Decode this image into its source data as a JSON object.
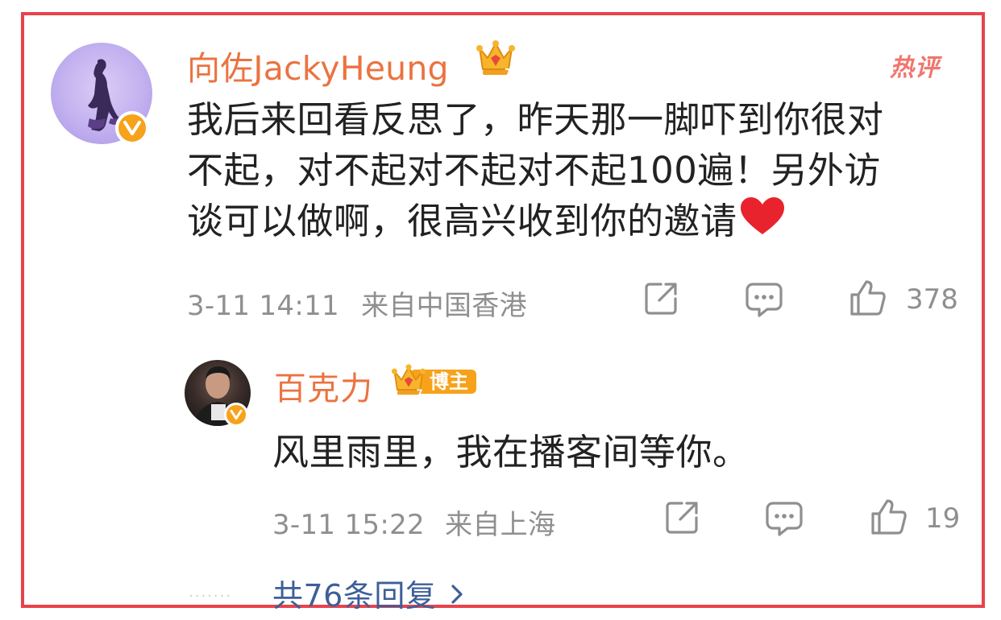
{
  "comment": {
    "username": "向佐JackyHeung",
    "hot_label": "热评",
    "text_line1": "我后来回看反思了，昨天那一脚吓到你很对",
    "text_line2": "不起，对不起对不起对不起100遍！另外访",
    "text_line3": "谈可以做啊，很高兴收到你的邀请",
    "time": "3-11 14:11",
    "location": "来自中国香港",
    "like_count": "378"
  },
  "reply": {
    "username": "百克力",
    "badge_label": "博主",
    "text": "风里雨里，我在播客间等你。",
    "time": "3-11 15:22",
    "location": "来自上海",
    "like_count": "19"
  },
  "more": {
    "dots": "·······",
    "label": "共76条回复"
  },
  "colors": {
    "username": "#eb7340",
    "border": "#e8434b",
    "link": "#3d5f99",
    "meta": "#8f8f8f",
    "verified": "#f7a21b"
  },
  "icons": [
    "crown-icon",
    "verified-icon",
    "share-icon",
    "comment-icon",
    "like-icon",
    "heart-icon",
    "chevron-right-icon"
  ]
}
